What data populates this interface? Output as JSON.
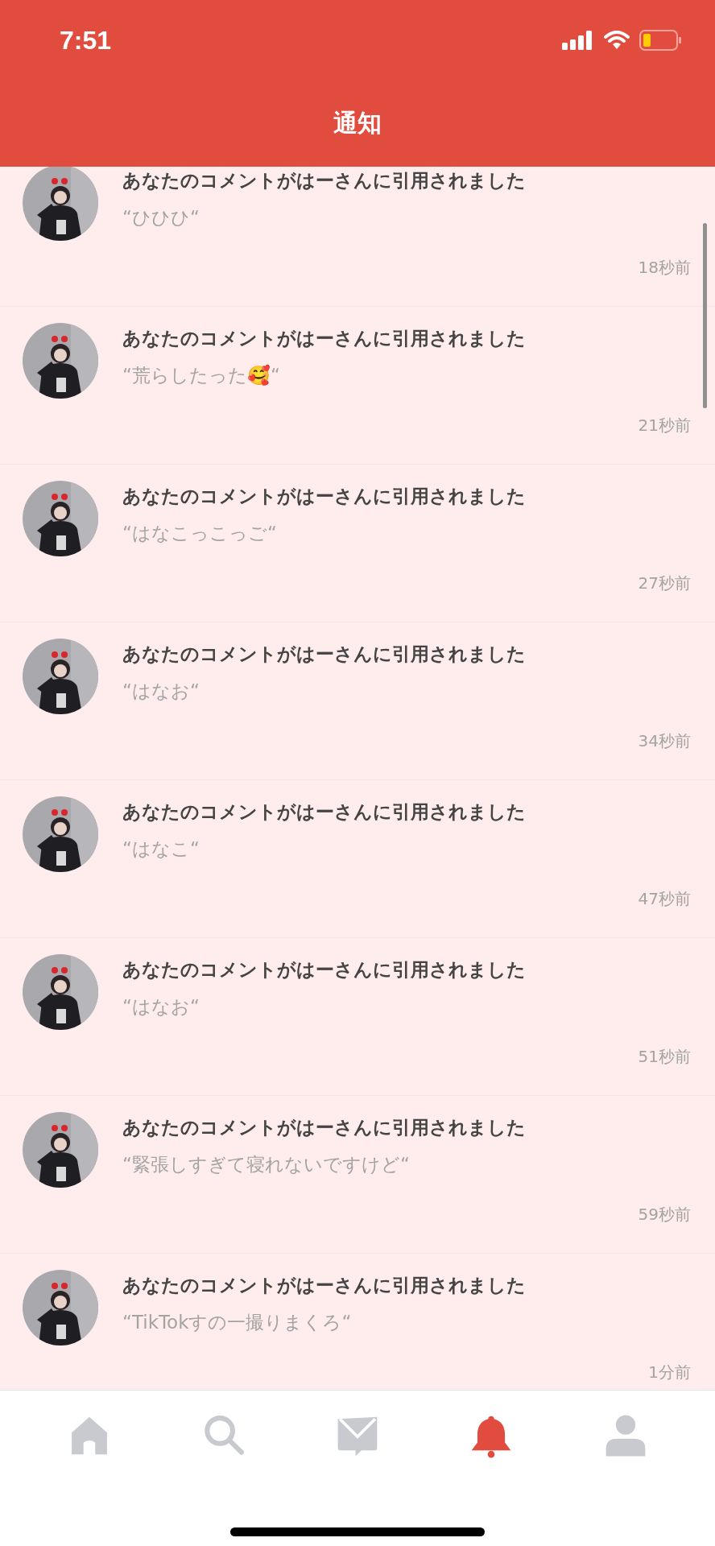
{
  "status_bar": {
    "time": "7:51"
  },
  "header": {
    "title": "通知"
  },
  "notifications": [
    {
      "message": "あなたのコメントがはーさんに引用されました",
      "quote": "“ひひひ“",
      "time": "18秒前"
    },
    {
      "message": "あなたのコメントがはーさんに引用されました",
      "quote": "“荒らしたった🥰“",
      "time": "21秒前"
    },
    {
      "message": "あなたのコメントがはーさんに引用されました",
      "quote": "“はなこっこっご“",
      "time": "27秒前"
    },
    {
      "message": "あなたのコメントがはーさんに引用されました",
      "quote": "“はなお“",
      "time": "34秒前"
    },
    {
      "message": "あなたのコメントがはーさんに引用されました",
      "quote": "“はなこ“",
      "time": "47秒前"
    },
    {
      "message": "あなたのコメントがはーさんに引用されました",
      "quote": "“はなお“",
      "time": "51秒前"
    },
    {
      "message": "あなたのコメントがはーさんに引用されました",
      "quote": "“緊張しすぎて寝れないですけど“",
      "time": "59秒前"
    },
    {
      "message": "あなたのコメントがはーさんに引用されました",
      "quote": "“TikTokすの一撮りまくろ“",
      "time": "1分前"
    }
  ],
  "tab_bar": [
    {
      "selected": false
    },
    {
      "selected": false
    },
    {
      "selected": false
    },
    {
      "selected": true
    },
    {
      "selected": false
    }
  ]
}
